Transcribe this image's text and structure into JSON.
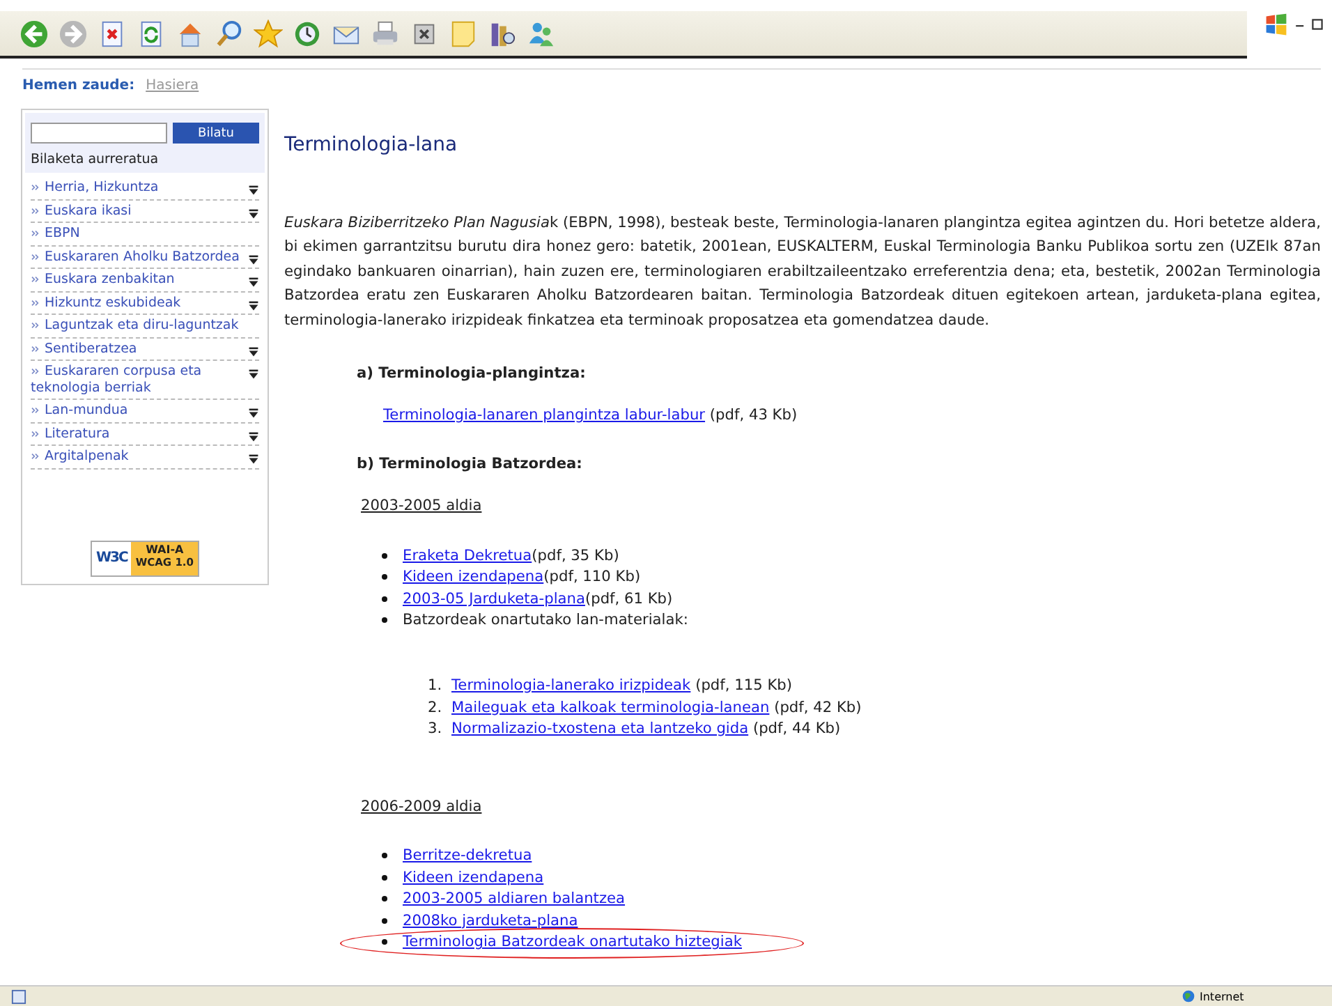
{
  "breadcrumb": {
    "label": "Hemen zaude:",
    "link": "Hasiera"
  },
  "sidebar": {
    "search_button": "Bilatu",
    "advanced_search": "Bilaketa aurreratua",
    "items": [
      {
        "label": "Herria, Hizkuntza",
        "expandable": true
      },
      {
        "label": "Euskara ikasi",
        "expandable": true
      },
      {
        "label": "EBPN",
        "expandable": false
      },
      {
        "label": "Euskararen Aholku Batzordea",
        "expandable": true
      },
      {
        "label": "Euskara zenbakitan",
        "expandable": true
      },
      {
        "label": "Hizkuntz eskubideak",
        "expandable": true
      },
      {
        "label": "Laguntzak eta diru-laguntzak",
        "expandable": false
      },
      {
        "label": "Sentiberatzea",
        "expandable": true
      },
      {
        "label": "Euskararen corpusa eta teknologia berriak",
        "expandable": true
      },
      {
        "label": "Lan-mundua",
        "expandable": true
      },
      {
        "label": "Literatura",
        "expandable": true
      },
      {
        "label": "Argitalpenak",
        "expandable": true
      }
    ],
    "badge": {
      "logo": "W3C",
      "line_1": "WAI-A",
      "line_2": "WCAG 1.0"
    }
  },
  "main": {
    "title": "Terminologia-lana",
    "intro_lead": "Euskara Biziberritzeko Plan Nagusia",
    "intro": "k (EBPN, 1998), besteak beste, Terminologia-lanaren plangintza egitea agintzen du. Hori betetze aldera, bi ekimen garrantzitsu burutu dira honez gero: batetik, 2001ean, EUSKALTERM, Euskal Terminologia Banku Publikoa sortu zen (UZEIk 87an egindako bankuaren oinarrian), hain zuzen ere, terminologiaren erabiltzaileentzako erreferentzia dena; eta, bestetik, 2002an Terminologia Batzordea eratu zen Euskararen Aholku Batzordearen baitan. Terminologia Batzordeak dituen egitekoen artean, jarduketa-plana egitea, terminologia-lanerako irizpideak finkatzea eta terminoak proposatzea eta gomendatzea daude.",
    "section_a": {
      "heading": "a) Terminologia-plangintza:",
      "link": "Terminologia-lanaren plangintza labur-labur",
      "note": "(pdf, 43 Kb)"
    },
    "section_b": {
      "heading": "b) Terminologia Batzordea:",
      "periods": [
        {
          "title": "2003-2005 aldia",
          "items": [
            {
              "kind": "link",
              "text": "Eraketa Dekretua",
              "note": "(pdf, 35 Kb)",
              "circled": false
            },
            {
              "kind": "link",
              "text": "Kideen izendapena",
              "note": "(pdf, 110 Kb)",
              "circled": false
            },
            {
              "kind": "link",
              "text": "2003-05 Jarduketa-plana",
              "note": "(pdf, 61 Kb)",
              "circled": false
            },
            {
              "kind": "text",
              "text": "Batzordeak onartutako lan-materialak:",
              "circled": false
            }
          ],
          "numbered": [
            {
              "number": "1.",
              "text": "Terminologia-lanerako irizpideak",
              "note": "(pdf, 115 Kb)"
            },
            {
              "number": "2.",
              "text": "Maileguak eta kalkoak terminologia-lanean",
              "note": "(pdf, 42 Kb)"
            },
            {
              "number": "3.",
              "text": "Normalizazio-txostena eta lantzeko gida",
              "note": "(pdf, 44 Kb)"
            }
          ]
        },
        {
          "title": "2006-2009 aldia",
          "items": [
            {
              "kind": "link",
              "text": "Berritze-dekretua",
              "circled": false
            },
            {
              "kind": "link",
              "text": "Kideen izendapena",
              "circled": false
            },
            {
              "kind": "link",
              "text": "2003-2005 aldiaren balantzea",
              "circled": false
            },
            {
              "kind": "link",
              "text": "2008ko jarduketa-plana",
              "circled": false
            },
            {
              "kind": "link",
              "text": "Terminologia Batzordeak onartutako hiztegiak",
              "circled": true
            }
          ]
        }
      ]
    }
  },
  "status_bar": {
    "zone": "Internet"
  }
}
